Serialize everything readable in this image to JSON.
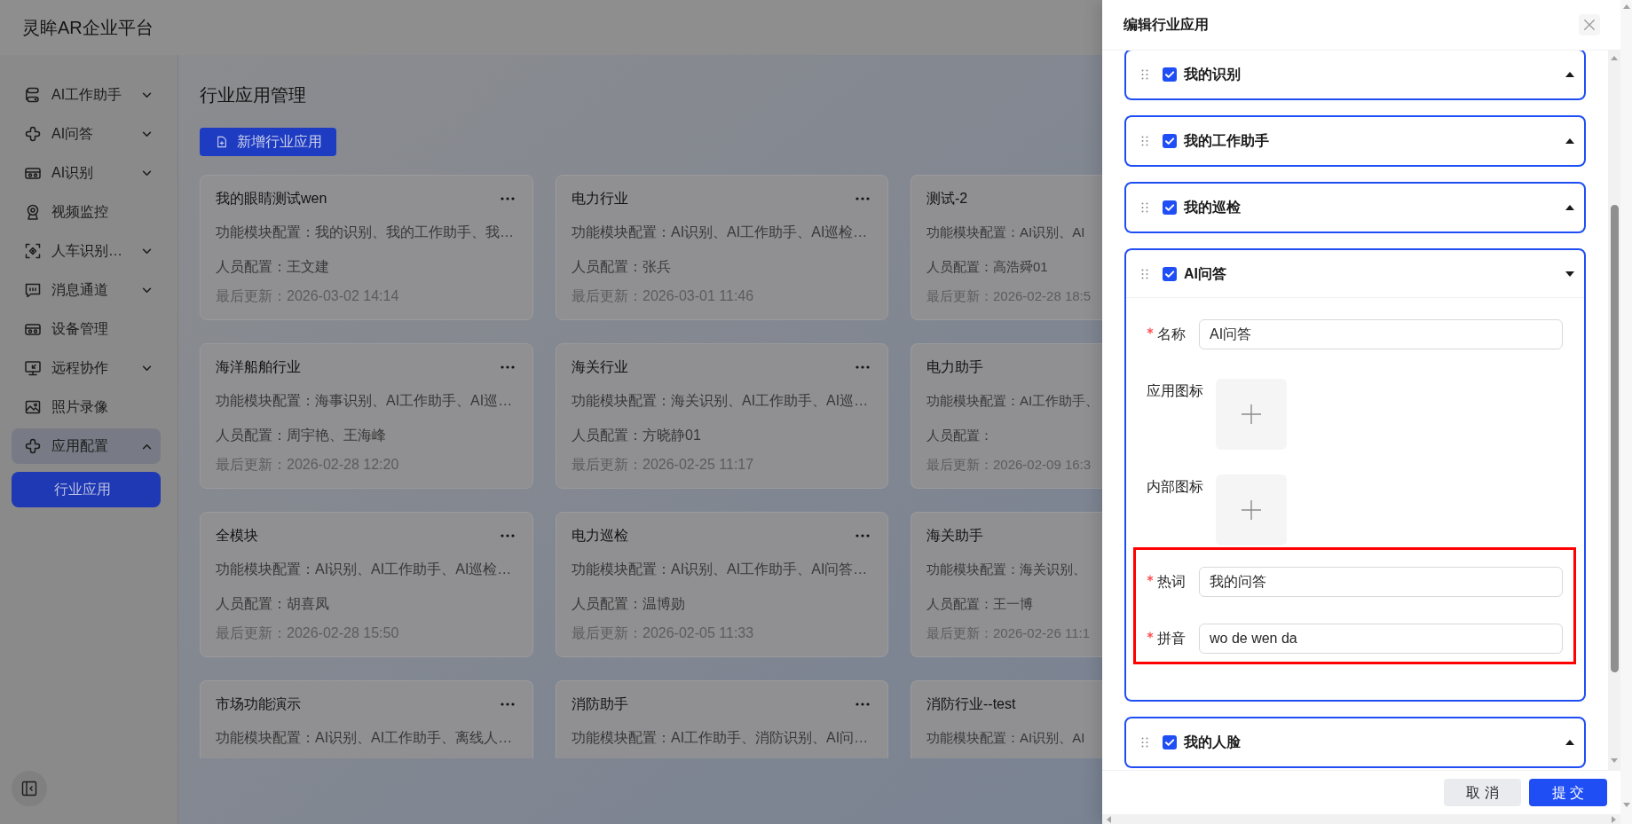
{
  "app": {
    "title": "灵眸AR企业平台"
  },
  "sidebar": {
    "items": [
      {
        "label": "AI工作助手",
        "kind": "group",
        "expanded": false,
        "selected": false
      },
      {
        "label": "AI问答",
        "kind": "group",
        "expanded": false,
        "selected": false
      },
      {
        "label": "AI识别",
        "kind": "group",
        "expanded": false,
        "selected": false
      },
      {
        "label": "视频监控",
        "kind": "link",
        "selected": false
      },
      {
        "label": "人车识别…",
        "kind": "group",
        "expanded": false,
        "selected": false
      },
      {
        "label": "消息通道",
        "kind": "group",
        "expanded": false,
        "selected": false
      },
      {
        "label": "设备管理",
        "kind": "link",
        "selected": false
      },
      {
        "label": "远程协作",
        "kind": "group",
        "expanded": false,
        "selected": false
      },
      {
        "label": "照片录像",
        "kind": "link",
        "selected": false
      },
      {
        "label": "应用配置",
        "kind": "group",
        "expanded": true,
        "selected": true,
        "children": [
          {
            "label": "行业应用",
            "selected": true
          }
        ]
      }
    ]
  },
  "page": {
    "title": "行业应用管理",
    "add_button": "新增行业应用",
    "cards": [
      {
        "title": "我的眼睛测试wen",
        "more_button": true,
        "modules": "功能模块配置：我的识别、我的工作助手、我…",
        "people": "人员配置：王文建",
        "updated": "最后更新：2026-03-02 14:14"
      },
      {
        "title": "电力行业",
        "more_button": true,
        "modules": "功能模块配置：AI识别、AI工作助手、AI巡检…",
        "people": "人员配置：张兵",
        "updated": "最后更新：2026-03-01 11:46"
      },
      {
        "title": "测试-2",
        "more_button": false,
        "modules": "功能模块配置：AI识别、AI",
        "people": "人员配置：高浩舜01",
        "updated": "最后更新：2026-02-28 18:5"
      },
      {
        "title": "海洋船舶行业",
        "more_button": true,
        "modules": "功能模块配置：海事识别、AI工作助手、AI巡…",
        "people": "人员配置：周宇艳、王海峰",
        "updated": "最后更新：2026-02-28 12:20"
      },
      {
        "title": "海关行业",
        "more_button": true,
        "modules": "功能模块配置：海关识别、AI工作助手、AI巡…",
        "people": "人员配置：方晓静01",
        "updated": "最后更新：2026-02-25 11:17"
      },
      {
        "title": "电力助手",
        "more_button": false,
        "modules": "功能模块配置：AI工作助手、",
        "people": "人员配置：",
        "updated": "最后更新：2026-02-09 16:3"
      },
      {
        "title": "全模块",
        "more_button": true,
        "modules": "功能模块配置：AI识别、AI工作助手、AI巡检…",
        "people": "人员配置：胡喜凤",
        "updated": "最后更新：2026-02-28 15:50"
      },
      {
        "title": "电力巡检",
        "more_button": true,
        "modules": "功能模块配置：AI识别、AI工作助手、AI问答…",
        "people": "人员配置：温博勋",
        "updated": "最后更新：2026-02-05 11:33"
      },
      {
        "title": "海关助手",
        "more_button": false,
        "modules": "功能模块配置：海关识别、",
        "people": "人员配置：王一博",
        "updated": "最后更新：2026-02-26 11:1"
      },
      {
        "title": "市场功能演示",
        "more_button": true,
        "modules": "功能模块配置：AI识别、AI工作助手、离线人…"
      },
      {
        "title": "消防助手",
        "more_button": true,
        "modules": "功能模块配置：AI工作助手、消防识别、AI问…"
      },
      {
        "title": "消防行业--test",
        "more_button": false,
        "modules": "功能模块配置：AI识别、AI"
      }
    ]
  },
  "drawer": {
    "title": "编辑行业应用",
    "panels": [
      {
        "label": "我的识别",
        "checked": true,
        "expanded": false
      },
      {
        "label": "我的工作助手",
        "checked": true,
        "expanded": false
      },
      {
        "label": "我的巡检",
        "checked": true,
        "expanded": false
      },
      {
        "label": "AI问答",
        "checked": true,
        "expanded": true,
        "fields": [
          {
            "kind": "text",
            "label": "名称",
            "required": true,
            "value": "AI问答",
            "highlighted": false
          },
          {
            "kind": "upload",
            "label": "应用图标",
            "required": false,
            "highlighted": false
          },
          {
            "kind": "upload",
            "label": "内部图标",
            "required": false,
            "highlighted": false
          },
          {
            "kind": "text",
            "label": "热词",
            "required": true,
            "value": "我的问答",
            "highlighted": true
          },
          {
            "kind": "text",
            "label": "拼音",
            "required": true,
            "value": "wo de wen da",
            "highlighted": true
          }
        ]
      },
      {
        "label": "我的人脸",
        "checked": true,
        "expanded": false
      }
    ],
    "buttons": [
      {
        "label": "取 消",
        "kind": "secondary"
      },
      {
        "label": "提 交",
        "kind": "primary"
      }
    ]
  }
}
